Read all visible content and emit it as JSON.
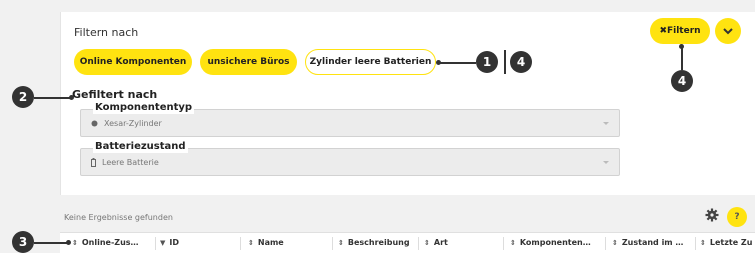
{
  "filter": {
    "title": "Filtern nach",
    "chips": [
      "Online Komponenten",
      "unsichere Büros",
      "Zylinder leere Batterien"
    ],
    "filter_button": "✖Filtern"
  },
  "applied": {
    "title": "Gefiltert nach",
    "fields": [
      {
        "label": "Komponententyp",
        "value": "Xesar-Zylinder"
      },
      {
        "label": "Batteriezustand",
        "value": "Leere Batterie"
      }
    ]
  },
  "results": {
    "empty_text": "Keine Ergebnisse gefunden",
    "help": "?"
  },
  "table": {
    "columns": [
      "Online-Zus…",
      "ID",
      "Name",
      "Beschreibung",
      "Art",
      "Komponenten…",
      "Zustand im …",
      "Letzte Zu"
    ]
  },
  "callouts": [
    "1",
    "4",
    "2",
    "3",
    "4"
  ],
  "colors": {
    "accent": "#ffe310",
    "callout": "#333333"
  }
}
